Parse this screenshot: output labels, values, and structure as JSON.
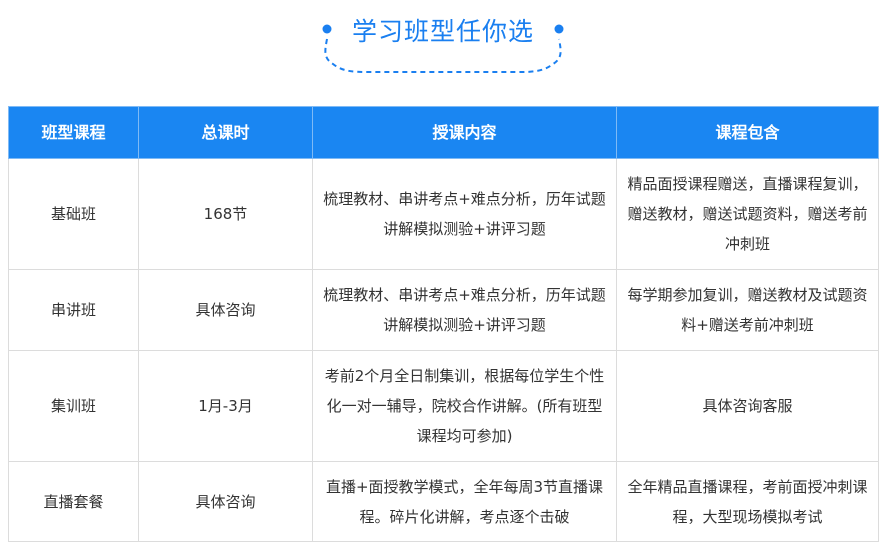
{
  "title": "学习班型任你选",
  "colors": {
    "accent": "#1a86f2",
    "title": "#1a7ff0",
    "border": "#dcdcdc"
  },
  "table": {
    "headers": [
      "班型课程",
      "总课时",
      "授课内容",
      "课程包含"
    ],
    "rows": [
      {
        "name": "基础班",
        "hours": "168节",
        "content": "梳理教材、串讲考点+难点分析，历年试题讲解模拟测验+讲评习题",
        "includes": "精品面授课程赠送，直播课程复训，赠送教材，赠送试题资料，赠送考前冲刺班"
      },
      {
        "name": "串讲班",
        "hours": "具体咨询",
        "content": "梳理教材、串讲考点+难点分析，历年试题讲解模拟测验+讲评习题",
        "includes": "每学期参加复训，赠送教材及试题资料+赠送考前冲刺班"
      },
      {
        "name": "集训班",
        "hours": "1月-3月",
        "content": "考前2个月全日制集训，根据每位学生个性化一对一辅导，院校合作讲解。(所有班型课程均可参加)",
        "includes": "具体咨询客服"
      },
      {
        "name": "直播套餐",
        "hours": "具体咨询",
        "content": "直播+面授教学模式，全年每周3节直播课程。碎片化讲解，考点逐个击破",
        "includes": "全年精品直播课程，考前面授冲刺课程，大型现场模拟考试"
      }
    ]
  }
}
